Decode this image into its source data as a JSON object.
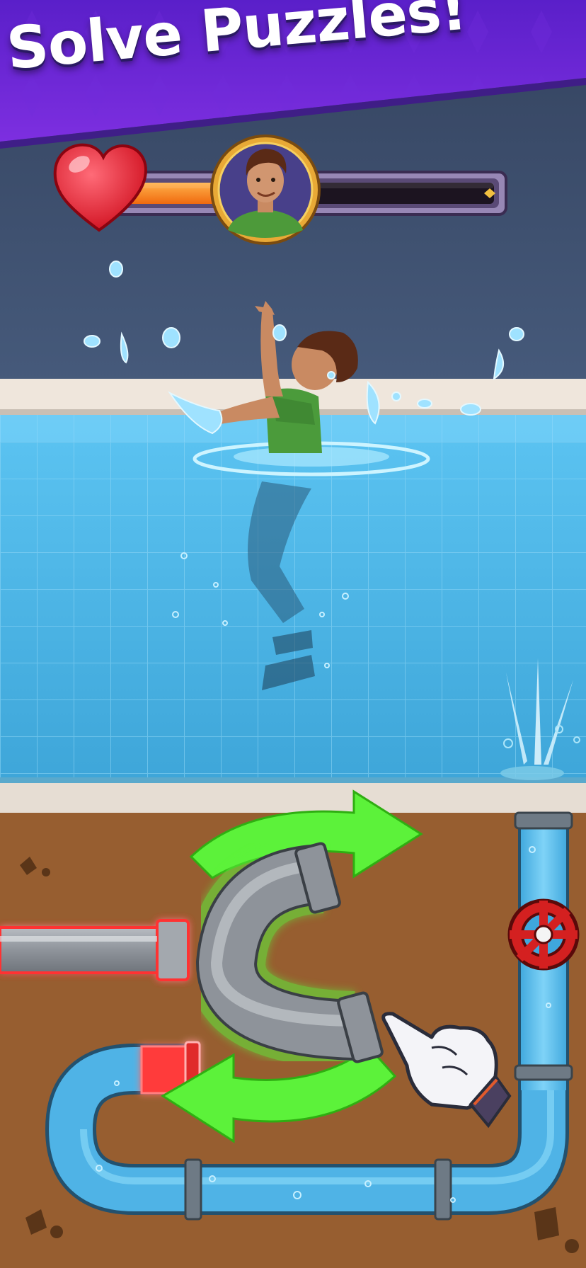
{
  "banner": {
    "title": "Solve Puzzles!",
    "colors": {
      "top": "#5a1fc9",
      "bottom": "#7d2fe0"
    }
  },
  "hud": {
    "life_icon": "heart-icon",
    "avatar": "character-portrait",
    "health_fraction": 0.38,
    "colors": {
      "fill": "#ff8a1f",
      "track": "#1c1420",
      "frame": "#8a7aa8"
    }
  },
  "scene": {
    "wall_color": "#3b4d6c",
    "pool_water_color": "#4fb6e6",
    "ground_color": "#9b6233",
    "pipe_water_color": "#5ac2f0",
    "leak_indicator_color": "#ff3b3b",
    "selected_glow_color": "#5cf23a",
    "valve_color": "#d42020"
  },
  "puzzle": {
    "hint": "rotate-arrows-icon",
    "hand_cursor": "pointing-hand-icon"
  }
}
